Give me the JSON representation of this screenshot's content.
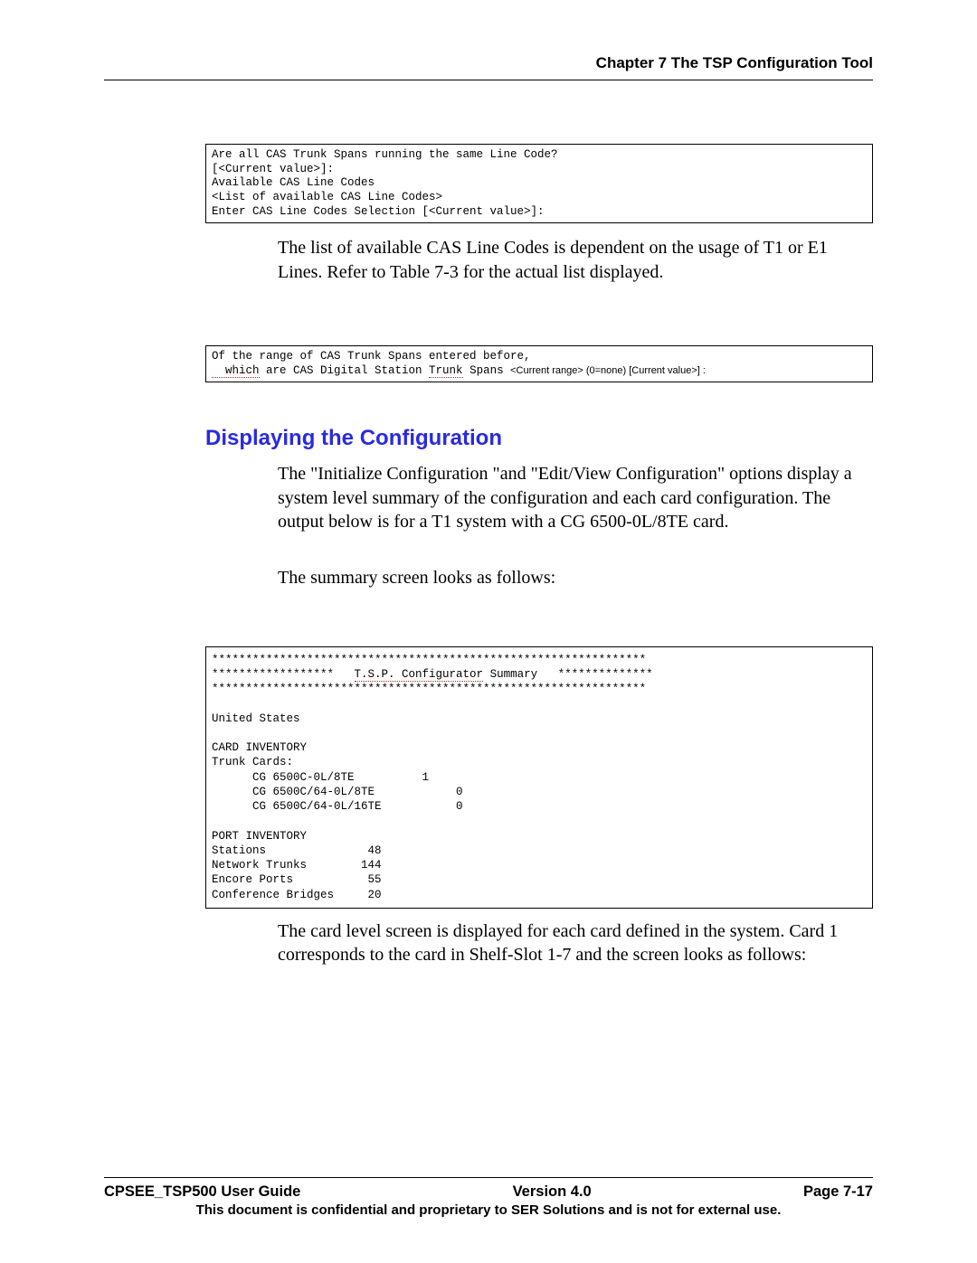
{
  "header": {
    "chapter": "Chapter 7 The TSP Configuration Tool"
  },
  "box1": {
    "l1": "Are all CAS Trunk Spans running the same Line Code?",
    "l2": "[<Current value>]:",
    "l3": "Available CAS Line Codes",
    "l4": "<List of available CAS Line Codes>",
    "l5": "Enter CAS Line Codes Selection [<Current value>]:"
  },
  "para1": "The list of available CAS Line Codes is dependent on the usage of T1 or E1 Lines.  Refer to Table 7-3 for the actual list displayed.",
  "box2": {
    "l1": "Of the range of CAS Trunk Spans entered before,",
    "l2a": "  which",
    "l2b": " are CAS Digital Station ",
    "l2c": "Trunk",
    "l2d": " Spans ",
    "l2e": "<Current range> (0=none) [Current value>] :"
  },
  "heading": "Displaying the Configuration",
  "para2": "The \"Initialize Configuration \"and \"Edit/View Configuration\" options display a system level summary of the configuration and each card configuration.  The output below is for a T1 system with a CG 6500-0L/8TE card.",
  "para3": "The summary screen looks as follows:",
  "box3": {
    "l1": "****************************************************************",
    "l2a": "******************   ",
    "l2b": "T.S.P. Configurator",
    "l2c": " Summary   **************",
    "l3": "****************************************************************",
    "l4": "",
    "l5": "United States",
    "l6": "",
    "l7": "CARD INVENTORY",
    "l8": "Trunk Cards:",
    "l9": "      CG 6500C-0L/8TE          1",
    "l10": "      CG 6500C/64-0L/8TE            0",
    "l11": "      CG 6500C/64-0L/16TE           0",
    "l12": "",
    "l13": "PORT INVENTORY",
    "l14": "Stations               48",
    "l15": "Network Trunks        144",
    "l16": "Encore Ports           55",
    "l17": "Conference Bridges     20"
  },
  "para4": "The card level screen is displayed for each card defined in the system.  Card 1 corresponds to the card in Shelf-Slot 1-7 and the screen looks as follows:",
  "footer": {
    "left": "CPSEE_TSP500 User Guide",
    "center": "Version 4.0",
    "right": "Page 7-17",
    "note": "This document is confidential and proprietary to SER Solutions and is not for external use."
  },
  "chart_data": {
    "type": "table",
    "title": "T.S.P. Configurator Summary",
    "region": "United States",
    "card_inventory": {
      "Trunk Cards": [
        {
          "name": "CG 6500C-0L/8TE",
          "count": 1
        },
        {
          "name": "CG 6500C/64-0L/8TE",
          "count": 0
        },
        {
          "name": "CG 6500C/64-0L/16TE",
          "count": 0
        }
      ]
    },
    "port_inventory": {
      "Stations": 48,
      "Network Trunks": 144,
      "Encore Ports": 55,
      "Conference Bridges": 20
    }
  }
}
